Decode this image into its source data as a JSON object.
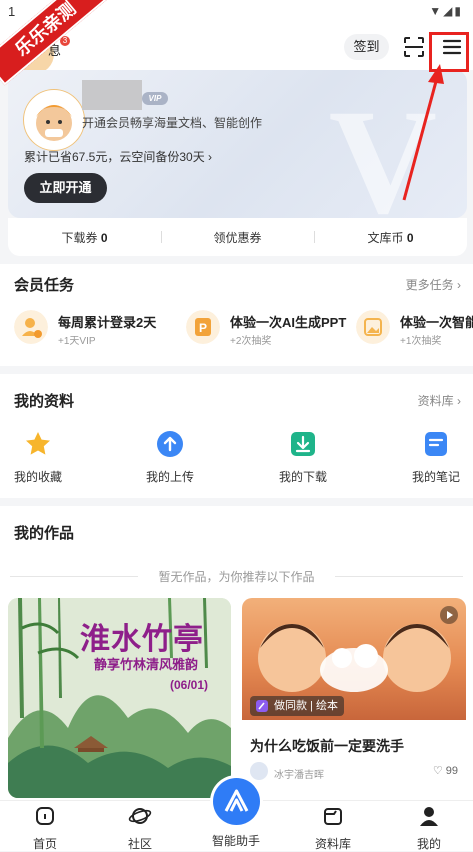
{
  "status_bar": {
    "time": "1"
  },
  "watermark": {
    "text": "乐乐亲测"
  },
  "header": {
    "message_label": "息",
    "message_badge": "3",
    "signin_label": "签到"
  },
  "vip": {
    "badge": "VIP",
    "subtitle": "开通会员畅享海量文档、智能创作",
    "stats": "累计已省67.5元，云空间备份30天 ›",
    "button": "立即开通",
    "coupons": [
      {
        "label": "下载券",
        "value": "0"
      },
      {
        "label": "领优惠券",
        "value": ""
      },
      {
        "label": "文库币",
        "value": "0"
      }
    ]
  },
  "tasks": {
    "title": "会员任务",
    "more": "更多任务 ›",
    "items": [
      {
        "title": "每周累计登录2天",
        "sub": "+1天VIP",
        "color": "#f6b24a"
      },
      {
        "title": "体验一次AI生成PPT",
        "sub": "+2次抽奖",
        "color": "#f2a33a"
      },
      {
        "title": "体验一次智能",
        "sub": "+1次抽奖",
        "color": "#f4b44e"
      }
    ]
  },
  "materials": {
    "title": "我的资料",
    "more": "资料库 ›",
    "items": [
      {
        "label": "我的收藏",
        "icon": "star-icon",
        "color": "#f7b52c"
      },
      {
        "label": "我的上传",
        "icon": "upload-icon",
        "color": "#3b87f5"
      },
      {
        "label": "我的下载",
        "icon": "download-icon",
        "color": "#1fb48a"
      },
      {
        "label": "我的笔记",
        "icon": "note-icon",
        "color": "#3b87f5"
      }
    ]
  },
  "works": {
    "title": "我的作品",
    "empty_text": "暂无作品，为你推荐以下作品",
    "card1": {
      "title": "淮水竹亭",
      "subtitle": "静享竹林清风雅韵",
      "date": "(06/01)"
    },
    "card2": {
      "tag": "做同款 | 绘本",
      "title": "为什么吃饭前一定要洗手",
      "author": "冰宇潘吉晖",
      "likes": "99"
    }
  },
  "bottom_nav": {
    "items": [
      {
        "label": "首页",
        "icon": "home-icon"
      },
      {
        "label": "社区",
        "icon": "planet-icon"
      },
      {
        "label": "智能助手",
        "icon": "ai-assistant-icon"
      },
      {
        "label": "资料库",
        "icon": "library-icon"
      },
      {
        "label": "我的",
        "icon": "profile-icon"
      }
    ]
  }
}
